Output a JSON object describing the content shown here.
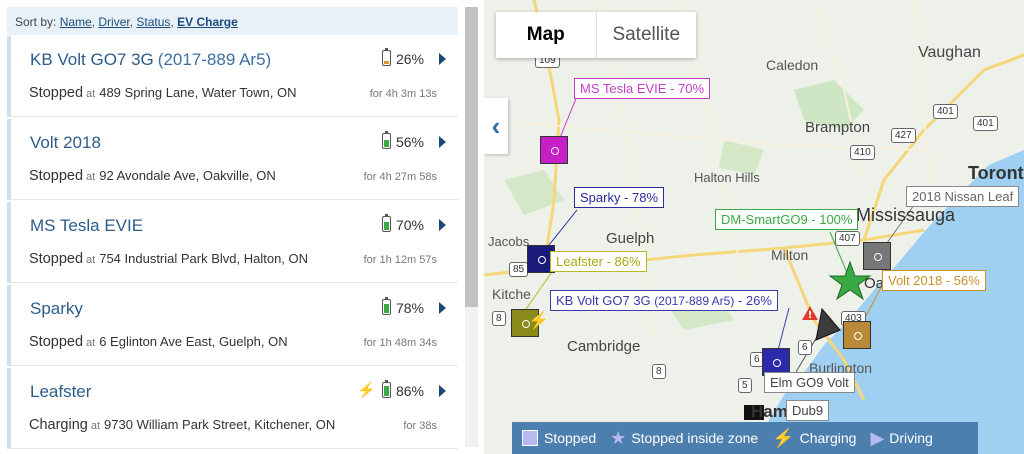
{
  "sort": {
    "prefix": "Sort by:",
    "options": [
      "Name",
      "Driver",
      "Status",
      "EV Charge"
    ],
    "active": "EV Charge"
  },
  "vehicles": [
    {
      "name": "KB Volt GO7 3G",
      "sub": "(2017-889 Ar5)",
      "charge": "26%",
      "charge_level": 0.26,
      "battery_color": "#d19a2b",
      "status": "Stopped",
      "at": "at",
      "address": "489 Spring Lane, Water Town, ON",
      "duration": "for 4h 3m 13s",
      "charging": false
    },
    {
      "name": "Volt 2018",
      "sub": "",
      "charge": "56%",
      "charge_level": 0.56,
      "battery_color": "#3aa843",
      "status": "Stopped",
      "at": "at",
      "address": "92 Avondale Ave, Oakville, ON",
      "duration": "for 4h 27m 58s",
      "charging": false
    },
    {
      "name": "MS Tesla EVIE",
      "sub": "",
      "charge": "70%",
      "charge_level": 0.7,
      "battery_color": "#3aa843",
      "status": "Stopped",
      "at": "at",
      "address": "754 Industrial Park Blvd, Halton, ON",
      "duration": "for 1h 12m 57s",
      "charging": false
    },
    {
      "name": "Sparky",
      "sub": "",
      "charge": "78%",
      "charge_level": 0.78,
      "battery_color": "#3aa843",
      "status": "Stopped",
      "at": "at",
      "address": "6 Eglinton Ave East, Guelph, ON",
      "duration": "for 1h 48m 34s",
      "charging": false
    },
    {
      "name": "Leafster",
      "sub": "",
      "charge": "86%",
      "charge_level": 0.86,
      "battery_color": "#3aa843",
      "status": "Charging",
      "at": "at",
      "address": "9730 William Park Street, Kitchener, ON",
      "duration": "for 38s",
      "charging": true
    }
  ],
  "map": {
    "tabs": [
      "Map",
      "Satellite"
    ],
    "active_tab": "Map",
    "places": [
      "Caledon",
      "Vaughan",
      "Brampton",
      "Toront",
      "Halton Hills",
      "Mississauga",
      "Milton",
      "Guelph",
      "Jacobs",
      "Kitche",
      "Cambridge",
      "Burlington",
      "Ham",
      "Oakv"
    ],
    "highways": [
      "109",
      "427",
      "401",
      "410",
      "401",
      "407",
      "403",
      "85",
      "8",
      "8",
      "6",
      "5",
      "6"
    ],
    "vehicle_labels": [
      {
        "text": "MS Tesla EVIE - 70%",
        "color": "#c43fc4"
      },
      {
        "text": "Sparky - 78%",
        "color": "#2a2a9a"
      },
      {
        "text": "Leafster - 86%",
        "color": "#b8b820"
      },
      {
        "text": "KB Volt GO7 3G",
        "sub": "(2017-889 Ar5)",
        "pct": "- 26%",
        "color": "#3a3ab0"
      },
      {
        "text": "DM-SmartGO9 - 100%",
        "color": "#3aa843"
      },
      {
        "text": "2018 Nissan Leaf",
        "color": "#777777"
      },
      {
        "text": "Volt 2018 - 56%",
        "color": "#c8922c"
      },
      {
        "text": "Elm GO9 Volt",
        "color": "#444444"
      },
      {
        "text": "Dub9",
        "color": "#444444"
      }
    ],
    "legend": [
      "Stopped",
      "Stopped inside zone",
      "Charging",
      "Driving"
    ]
  }
}
